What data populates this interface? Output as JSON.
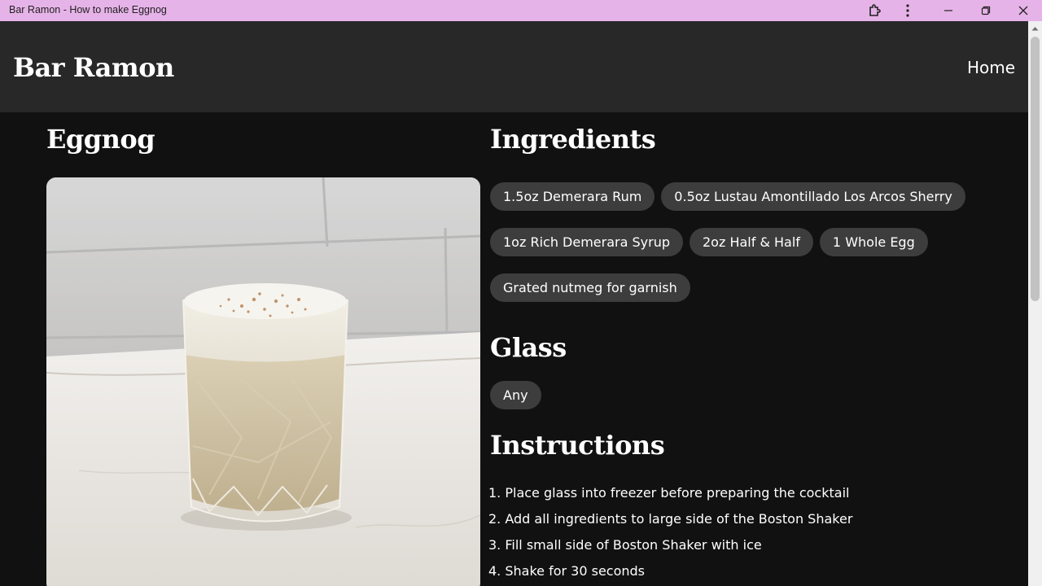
{
  "window": {
    "title": "Bar Ramon - How to make Eggnog",
    "icons": [
      "extensions-icon",
      "more-vert-icon",
      "minimize-icon",
      "restore-icon",
      "close-icon"
    ]
  },
  "nav": {
    "brand": "Bar Ramon",
    "home": "Home"
  },
  "drink": {
    "name": "Eggnog",
    "image_alt": "Eggnog in a cut glass tumbler topped with grated nutmeg"
  },
  "sections": {
    "ingredients": "Ingredients",
    "glass": "Glass",
    "instructions": "Instructions"
  },
  "ingredients": [
    "1.5oz Demerara Rum",
    "0.5oz Lustau Amontillado Los Arcos Sherry",
    "1oz Rich Demerara Syrup",
    "2oz Half & Half",
    "1 Whole Egg",
    "Grated nutmeg for garnish"
  ],
  "glass": [
    "Any"
  ],
  "instructions": [
    "1. Place glass into freezer before preparing the cocktail",
    "2. Add all ingredients to large side of the Boston Shaker",
    "3. Fill small side of Boston Shaker with ice",
    "4. Shake for 30 seconds"
  ],
  "colors": {
    "titlebar": "#e6b3e8",
    "navbar": "#282828",
    "background": "#111111",
    "chip": "#3d3d3d"
  }
}
